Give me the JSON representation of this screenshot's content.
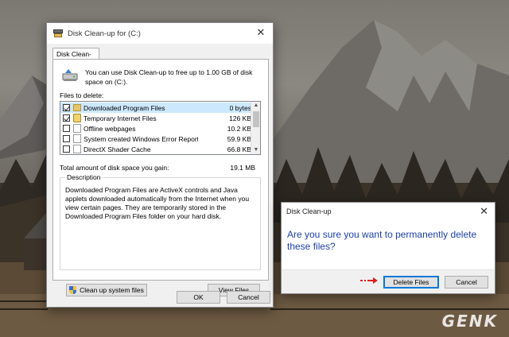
{
  "main_window": {
    "title": "Disk Clean-up for  (C:)",
    "tab_label": "Disk Clean-up",
    "intro_text": "You can use Disk Clean-up to free up to 1.00 GB of disk space on  (C:).",
    "files_to_delete_label": "Files to delete:",
    "files": [
      {
        "name": "Downloaded Program Files",
        "size": "0 bytes",
        "checked": true
      },
      {
        "name": "Temporary Internet Files",
        "size": "126 KB",
        "checked": true
      },
      {
        "name": "Offline webpages",
        "size": "10.2 KB",
        "checked": false
      },
      {
        "name": "System created Windows Error Reporti...",
        "size": "59.9 KB",
        "checked": false
      },
      {
        "name": "DirectX Shader Cache",
        "size": "66.8 KB",
        "checked": false
      }
    ],
    "total_label": "Total amount of disk space you gain:",
    "total_value": "19.1 MB",
    "description_legend": "Description",
    "description_text": "Downloaded Program Files are ActiveX controls and Java applets downloaded automatically from the Internet when you view certain pages. They are temporarily stored in the Downloaded Program Files folder on your hard disk.",
    "cleanup_system_label": "Clean up system files",
    "view_files_label": "View Files",
    "ok_label": "OK",
    "cancel_label": "Cancel"
  },
  "confirm_dialog": {
    "title": "Disk Clean-up",
    "message": "Are you sure you want to permanently delete these files?",
    "delete_label": "Delete Files",
    "cancel_label": "Cancel"
  },
  "watermark": "GENK",
  "colors": {
    "accent": "#0078d7",
    "message": "#1c3fa8",
    "selection": "#cce8ff",
    "arrow": "#e02020"
  }
}
